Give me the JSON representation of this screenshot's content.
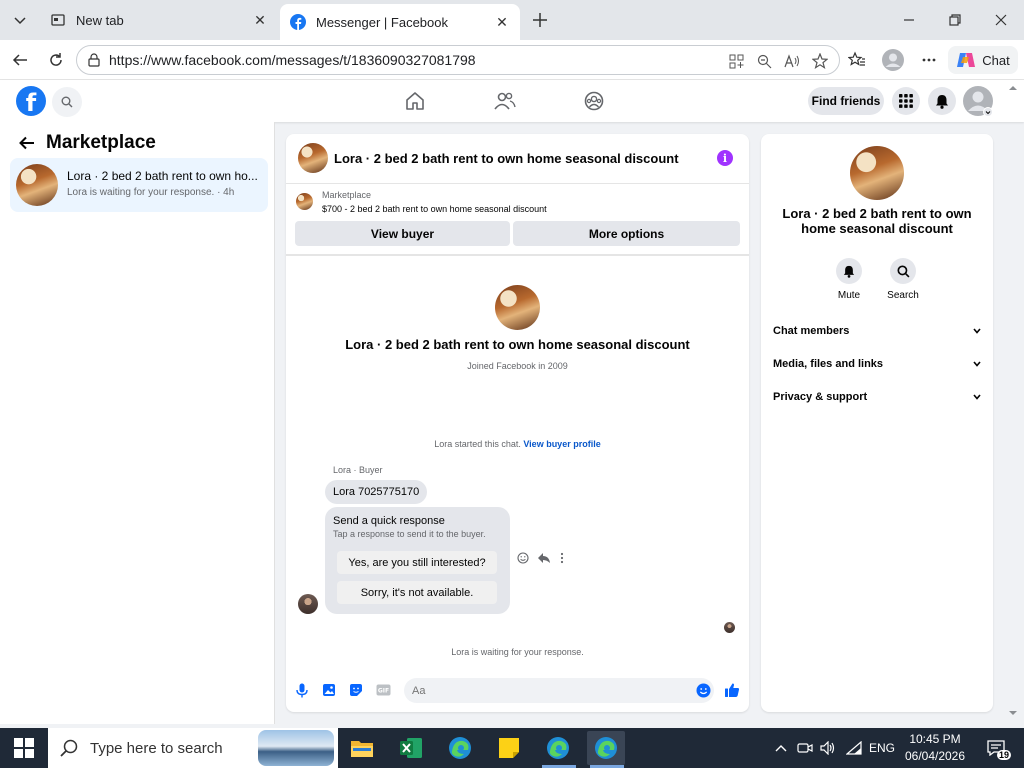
{
  "browser": {
    "tabs": [
      {
        "label": "New tab"
      },
      {
        "label": "Messenger | Facebook"
      }
    ],
    "url": "https://www.facebook.com/messages/t/1836090327081798",
    "copilot_label": "Chat"
  },
  "fb_header": {
    "logo": "f",
    "find_friends": "Find friends"
  },
  "left_panel": {
    "title": "Marketplace",
    "conversation": {
      "name": "Lora · 2 bed 2 bath rent to own ho...",
      "subtitle": "Lora is waiting for your response. · 4h"
    }
  },
  "chat": {
    "title": "Lora · 2 bed 2 bath rent to own home seasonal discount",
    "listing": {
      "category": "Marketplace",
      "price_title": "$700 - 2 bed 2 bath rent to own home seasonal discount",
      "view_buyer": "View buyer",
      "more_options": "More options"
    },
    "intro": {
      "name": "Lora · 2 bed 2 bath rent to own home seasonal discount",
      "joined": "Joined Facebook in 2009"
    },
    "started_text": "Lora started this chat.",
    "started_link": "View buyer profile",
    "sender_label": "Lora · Buyer",
    "message": "Lora 7025775170",
    "quick_response": {
      "title": "Send a quick response",
      "subtitle": "Tap a response to send it to the buyer.",
      "option1": "Yes, are you still interested?",
      "option2": "Sorry, it's not available."
    },
    "waiting": "Lora is waiting for your response.",
    "composer_placeholder": "Aa"
  },
  "right_panel": {
    "name": "Lora · 2 bed 2 bath rent to own home seasonal discount",
    "mute": "Mute",
    "search": "Search",
    "rows": [
      "Chat members",
      "Media, files and links",
      "Privacy & support"
    ]
  },
  "taskbar": {
    "search_placeholder": "Type here to search",
    "language": "ENG",
    "time": "10:45 PM",
    "date": "06/04/2026",
    "notifications": "19"
  },
  "colors": {
    "fb_blue": "#1877f2",
    "info_purple": "#a033ff",
    "link_blue": "#0a58ca",
    "active_conv_bg": "#ebf5ff"
  }
}
